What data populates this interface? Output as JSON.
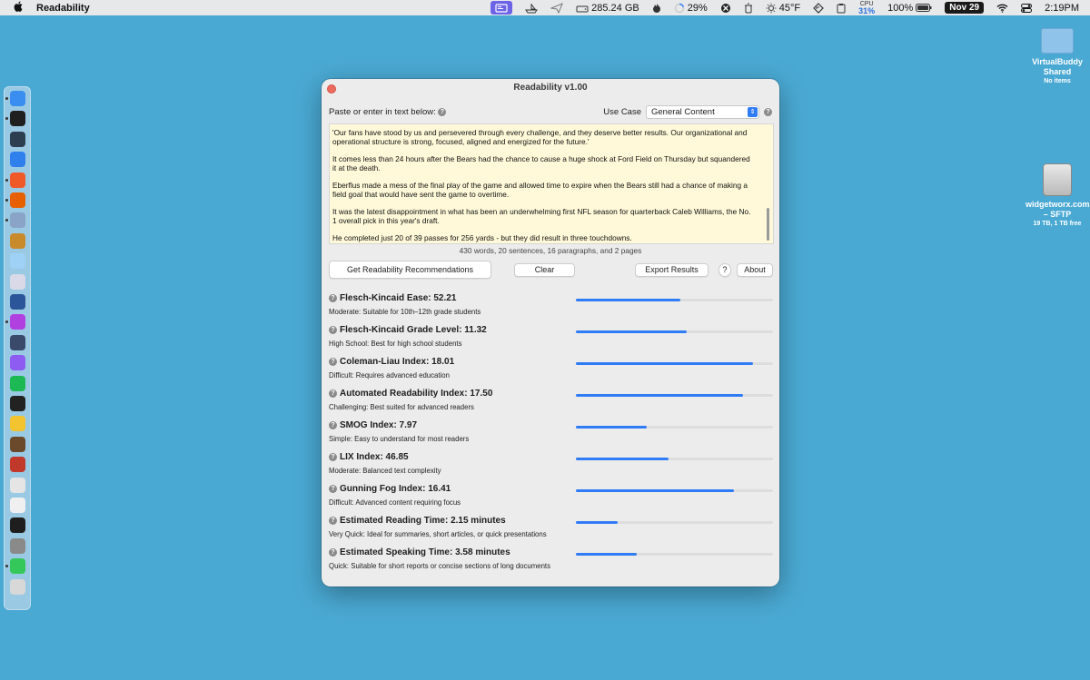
{
  "menubar": {
    "app_name": "Readability",
    "disk": "285.24 GB",
    "battery_circle": "29%",
    "temperature": "45°F",
    "cpu_label": "CPU",
    "cpu_value": "31%",
    "battery": "100%",
    "date": "Nov 29",
    "time": "2:19PM"
  },
  "desktop": {
    "shared_folder": {
      "label": "VirtualBuddy Shared",
      "sub": "No items"
    },
    "sftp": {
      "label": "widgetworx.com – SFTP",
      "sub": "19 TB, 1 TB free"
    }
  },
  "window": {
    "title": "Readability v1.00",
    "paste_label": "Paste or enter in text below:",
    "use_case_label": "Use Case",
    "use_case_value": "General Content",
    "text_paragraphs": [
      "'Our fans have stood by us and persevered through every challenge, and they deserve better results. Our organizational and operational structure is strong, focused, aligned and energized for the future.'",
      "It comes less than 24 hours after the Bears had the chance to cause a huge shock at Ford Field on Thursday but squandered it at the death.",
      "Eberflus made a mess of the final play of the game and allowed time to expire when the Bears still had a chance of making a field goal that would have sent the game to overtime.",
      "It was the latest disappointment in what has been an underwhelming first NFL season for quarterback Caleb Williams, the No. 1 overall pick in this year's draft.",
      "He completed just 20 of 39 passes for 256 yards - but they did result in three touchdowns."
    ],
    "stats": "430 words, 20 sentences, 16 paragraphs, and 2 pages",
    "buttons": {
      "recommend": "Get Readability Recommendations",
      "clear": "Clear",
      "export": "Export Results",
      "help": "?",
      "about": "About"
    },
    "metrics": [
      {
        "title": "Flesch-Kincaid Ease: 52.21",
        "desc": "Moderate: Suitable for 10th–12th grade students",
        "level": 0.53
      },
      {
        "title": "Flesch-Kincaid Grade Level: 11.32",
        "desc": "High School: Best for high school students",
        "level": 0.56
      },
      {
        "title": "Coleman-Liau Index: 18.01",
        "desc": "Difficult: Requires advanced education",
        "level": 0.9
      },
      {
        "title": "Automated Readability Index: 17.50",
        "desc": "Challenging: Best suited for advanced readers",
        "level": 0.85
      },
      {
        "title": "SMOG Index: 7.97",
        "desc": "Simple: Easy to understand for most readers",
        "level": 0.36
      },
      {
        "title": "LIX Index: 46.85",
        "desc": "Moderate: Balanced text complexity",
        "level": 0.47
      },
      {
        "title": "Gunning Fog Index: 16.41",
        "desc": "Difficult: Advanced content requiring focus",
        "level": 0.8
      },
      {
        "title": "Estimated Reading Time: 2.15 minutes",
        "desc": "Very Quick: Ideal for summaries, short articles, or quick presentations",
        "level": 0.21
      },
      {
        "title": "Estimated Speaking Time: 3.58 minutes",
        "desc": "Quick: Suitable for short reports or concise sections of long documents",
        "level": 0.31
      }
    ],
    "help_glyph": "?"
  },
  "colors": {
    "desktop": "#4aa9d3",
    "accent": "#2f7cf6",
    "close": "#ed6a5e",
    "text_bg": "#fff9d9"
  },
  "dock_icons": [
    {
      "name": "finder-icon",
      "color": "#3a8ef0"
    },
    {
      "name": "app-store-like-icon",
      "color": "#1f1f1f"
    },
    {
      "name": "terminal-like-icon",
      "color": "#2c3e50"
    },
    {
      "name": "xcode-icon",
      "color": "#2f80ed"
    },
    {
      "name": "brave-icon",
      "color": "#f05a28"
    },
    {
      "name": "firefox-icon",
      "color": "#e66000"
    },
    {
      "name": "network-icon",
      "color": "#8aa4c8"
    },
    {
      "name": "cyberduck-icon",
      "color": "#c98a2b"
    },
    {
      "name": "preview-icon",
      "color": "#9fd0f5"
    },
    {
      "name": "bbedit-icon",
      "color": "#d9d9e8"
    },
    {
      "name": "word-icon",
      "color": "#2b579a"
    },
    {
      "name": "arc-icon",
      "color": "#b140e0"
    },
    {
      "name": "infuse-icon",
      "color": "#3a4a6b"
    },
    {
      "name": "podcast-icon",
      "color": "#8e5cf0"
    },
    {
      "name": "spotify-icon",
      "color": "#1db954"
    },
    {
      "name": "console-icon",
      "color": "#222222"
    },
    {
      "name": "drive-icon",
      "color": "#f4c430"
    },
    {
      "name": "script-icon",
      "color": "#6b4a2b"
    },
    {
      "name": "tool-icon",
      "color": "#c0392b"
    },
    {
      "name": "chatgpt-icon",
      "color": "#e5e5e5"
    },
    {
      "name": "ring-icon",
      "color": "#f0f0f0"
    },
    {
      "name": "activity-icon",
      "color": "#1e1e1e"
    },
    {
      "name": "settings-icon",
      "color": "#8a8a8a"
    },
    {
      "name": "messages-icon",
      "color": "#34c759"
    },
    {
      "name": "trash-icon",
      "color": "#d8d8d8"
    }
  ]
}
